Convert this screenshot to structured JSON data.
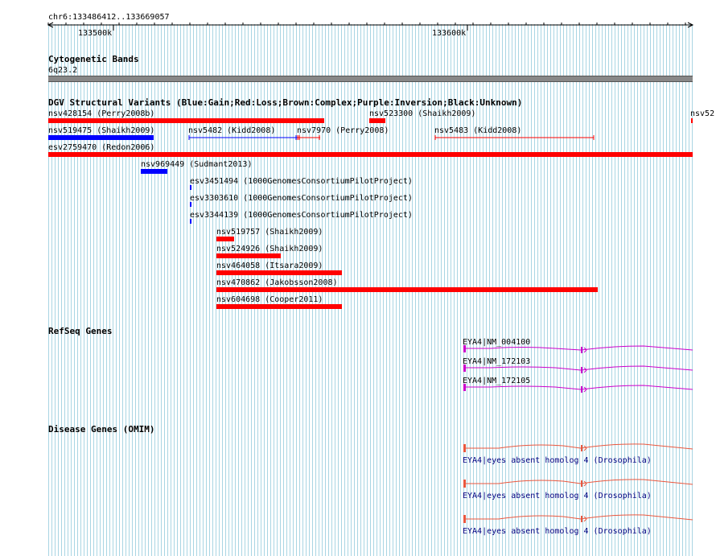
{
  "ruler": {
    "region": "chr6:133486412..133669057",
    "ticks": [
      "133500k",
      "133600k"
    ]
  },
  "cytoband": {
    "title": "Cytogenetic Bands",
    "band": "6q23.2"
  },
  "dgv": {
    "title": "DGV Structural Variants (Blue:Gain;Red:Loss;Brown:Complex;Purple:Inversion;Black:Unknown)",
    "features": [
      {
        "label": "nsv428154 (Perry2008b)",
        "type": "loss",
        "color": "#ff0000"
      },
      {
        "label": "nsv523300 (Shaikh2009)",
        "type": "loss",
        "color": "#ff0000"
      },
      {
        "label": "nsv52",
        "type": "loss",
        "color": "#ff0000"
      },
      {
        "label": "nsv519475 (Shaikh2009)",
        "type": "gain",
        "color": "#0000ff"
      },
      {
        "label": "nsv5482 (Kidd2008)",
        "type": "gain",
        "color": "#0000ff"
      },
      {
        "label": "nsv7970 (Perry2008)",
        "type": "loss",
        "color": "#ff0000"
      },
      {
        "label": "nsv5483 (Kidd2008)",
        "type": "loss",
        "color": "#ff0000"
      },
      {
        "label": "esv2759470 (Redon2006)",
        "type": "loss",
        "color": "#ff0000"
      },
      {
        "label": "nsv969449 (Sudmant2013)",
        "type": "gain",
        "color": "#0000ff"
      },
      {
        "label": "esv3451494 (1000GenomesConsortiumPilotProject)",
        "type": "gain",
        "color": "#0000ff"
      },
      {
        "label": "esv3303610 (1000GenomesConsortiumPilotProject)",
        "type": "gain",
        "color": "#0000ff"
      },
      {
        "label": "esv3344139 (1000GenomesConsortiumPilotProject)",
        "type": "gain",
        "color": "#0000ff"
      },
      {
        "label": "nsv519757 (Shaikh2009)",
        "type": "loss",
        "color": "#ff0000"
      },
      {
        "label": "nsv524926 (Shaikh2009)",
        "type": "loss",
        "color": "#ff0000"
      },
      {
        "label": "nsv464058 (Itsara2009)",
        "type": "loss",
        "color": "#ff0000"
      },
      {
        "label": "nsv470862 (Jakobsson2008)",
        "type": "loss",
        "color": "#ff0000"
      },
      {
        "label": "nsv604698 (Cooper2011)",
        "type": "loss",
        "color": "#ff0000"
      }
    ]
  },
  "refseq": {
    "title": "RefSeq Genes",
    "genes": [
      "EYA4|NM_004100",
      "EYA4|NM_172103",
      "EYA4|NM_172105"
    ],
    "color": "#cc00cc"
  },
  "omim": {
    "title": "Disease Genes (OMIM)",
    "genes": [
      "EYA4|eyes absent homolog 4 (Drosophila)",
      "EYA4|eyes absent homolog 4 (Drosophila)",
      "EYA4|eyes absent homolog 4 (Drosophila)"
    ],
    "color": "#e9573f",
    "label_color": "#000080"
  }
}
